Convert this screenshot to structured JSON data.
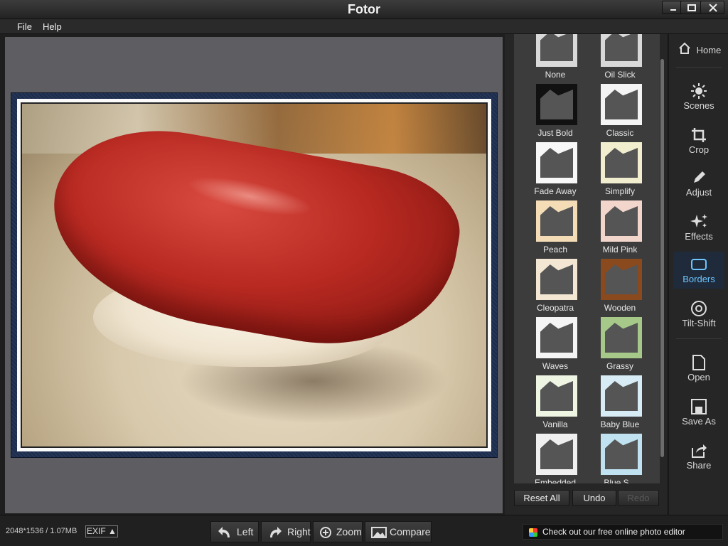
{
  "window": {
    "title": "Fotor"
  },
  "menu": {
    "file": "File",
    "help": "Help"
  },
  "borders": {
    "items": [
      {
        "label": "None",
        "style": "none"
      },
      {
        "label": "Oil Slick",
        "style": "oil"
      },
      {
        "label": "Just Bold",
        "style": "bold"
      },
      {
        "label": "Classic",
        "style": "classic"
      },
      {
        "label": "Fade Away",
        "style": "fade"
      },
      {
        "label": "Simplify",
        "style": "simplify"
      },
      {
        "label": "Peach",
        "style": "peach"
      },
      {
        "label": "Mild Pink",
        "style": "pink"
      },
      {
        "label": "Cleopatra",
        "style": "cleopatra"
      },
      {
        "label": "Wooden",
        "style": "wooden"
      },
      {
        "label": "Waves",
        "style": "waves"
      },
      {
        "label": "Grassy",
        "style": "grassy"
      },
      {
        "label": "Vanilla",
        "style": "vanilla"
      },
      {
        "label": "Baby Blue",
        "style": "babyblue"
      },
      {
        "label": "Embedded",
        "style": "embedded"
      },
      {
        "label": "Blue S...",
        "style": "bluestamp"
      }
    ],
    "reset_all": "Reset All",
    "undo": "Undo",
    "redo": "Redo"
  },
  "nav": {
    "home": "Home",
    "scenes": "Scenes",
    "crop": "Crop",
    "adjust": "Adjust",
    "effects": "Effects",
    "borders": "Borders",
    "tilt_shift": "Tilt-Shift",
    "open": "Open",
    "save_as": "Save As",
    "share": "Share",
    "active": "borders"
  },
  "status": {
    "image_info": "2048*1536 / 1.07MB",
    "exif": "EXIF ▲",
    "left": "Left",
    "right": "Right",
    "zoom": "Zoom",
    "compare": "Compare",
    "promo": "Check out our free online photo editor"
  },
  "colors": {
    "accent": "#6ec6ff",
    "frame": "#1d2c48"
  }
}
